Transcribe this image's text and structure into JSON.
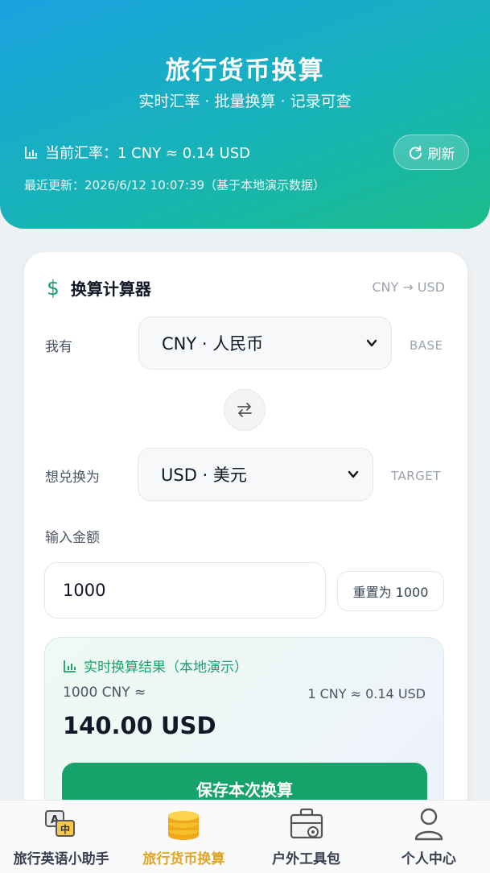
{
  "header": {
    "title": "旅行货币换算",
    "subtitle": "实时汇率 · 批量换算 · 记录可查",
    "rate_text": "当前汇率：1 CNY ≈ 0.14 USD",
    "refresh_label": "刷新",
    "update_text": "最近更新：2026/6/12 10:07:39（基于本地演示数据）"
  },
  "calculator": {
    "title": "换算计算器",
    "pair": "CNY → USD",
    "from_label": "我有",
    "from_value": "CNY · 人民币",
    "from_tag": "BASE",
    "to_label": "想兑换为",
    "to_value": "USD · 美元",
    "to_tag": "TARGET",
    "amount_label": "输入金额",
    "amount_value": "1000",
    "reset_label": "重置为 1000"
  },
  "result": {
    "title": "实时换算结果（本地演示）",
    "from_text": "1000 CNY ≈",
    "rate_text": "1 CNY ≈ 0.14 USD",
    "value": "140.00 USD",
    "save_label": "保存本次换算"
  },
  "tabs": [
    {
      "label": "旅行英语小助手",
      "icon": "translate-icon",
      "active": false
    },
    {
      "label": "旅行货币换算",
      "icon": "coins-icon",
      "active": true
    },
    {
      "label": "户外工具包",
      "icon": "toolbox-icon",
      "active": false
    },
    {
      "label": "个人中心",
      "icon": "user-icon",
      "active": false
    }
  ],
  "colors": {
    "accent": "#16a36b",
    "header_start": "#1aa3e0",
    "header_end": "#1bbd8a",
    "active_tab": "#e0a526"
  }
}
